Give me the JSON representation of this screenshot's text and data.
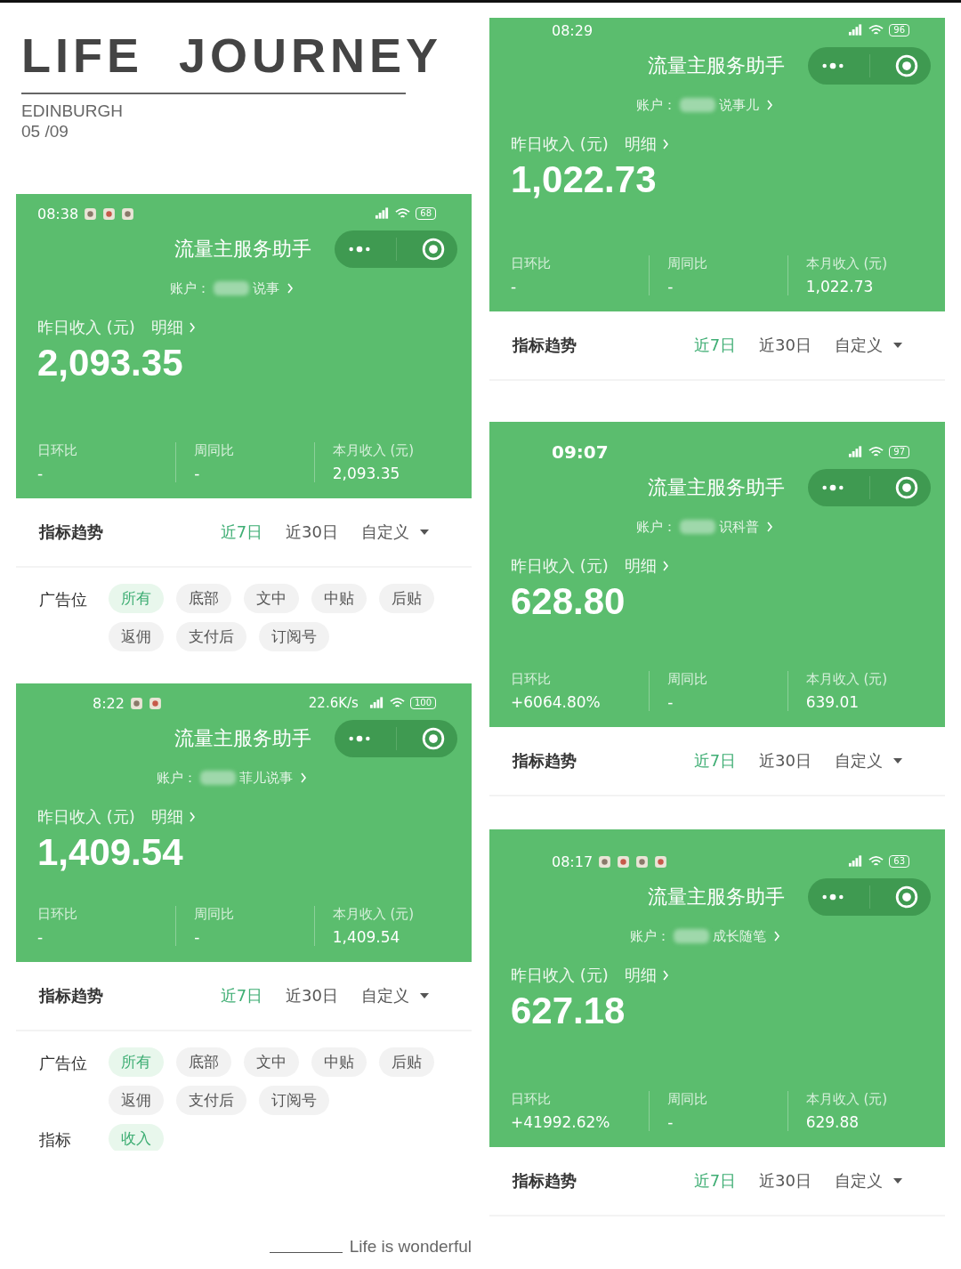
{
  "poster": {
    "title": "LIFE JOURNEY",
    "location": "EDINBURGH",
    "date": "05 /09",
    "footer": "Life is wonderful"
  },
  "left_column": [
    {
      "status_bar": {
        "time": "08:38",
        "battery": "68"
      },
      "app_title": "流量主服务助手",
      "account_label": "账户：",
      "account_name": "说事",
      "income_label": "昨日收入 (元)",
      "detail_link": "明细",
      "income": "2,093.35",
      "stats": [
        {
          "label": "日环比",
          "value": "-"
        },
        {
          "label": "周同比",
          "value": "-"
        },
        {
          "label": "本月收入 (元)",
          "value": "2,093.35"
        }
      ],
      "trend": {
        "title": "指标趋势",
        "tabs": [
          {
            "label": "近7日",
            "selected": true
          },
          {
            "label": "近30日",
            "selected": false
          },
          {
            "label": "自定义",
            "selected": false
          }
        ]
      },
      "filters": [
        {
          "label": "广告位",
          "chips": [
            {
              "label": "所有",
              "selected": true
            },
            {
              "label": "底部",
              "selected": false
            },
            {
              "label": "文中",
              "selected": false
            },
            {
              "label": "中贴",
              "selected": false
            },
            {
              "label": "后贴",
              "selected": false
            },
            {
              "label": "返佣",
              "selected": false
            },
            {
              "label": "支付后",
              "selected": false
            },
            {
              "label": "订阅号",
              "selected": false
            }
          ]
        }
      ]
    },
    {
      "status_bar": {
        "time": "8:22",
        "speed": "22.6K/s",
        "battery": "100"
      },
      "app_title": "流量主服务助手",
      "account_label": "账户：",
      "account_name": "菲儿说事",
      "income_label": "昨日收入 (元)",
      "detail_link": "明细",
      "income": "1,409.54",
      "stats": [
        {
          "label": "日环比",
          "value": "-"
        },
        {
          "label": "周同比",
          "value": "-"
        },
        {
          "label": "本月收入 (元)",
          "value": "1,409.54"
        }
      ],
      "trend": {
        "title": "指标趋势",
        "tabs": [
          {
            "label": "近7日",
            "selected": true
          },
          {
            "label": "近30日",
            "selected": false
          },
          {
            "label": "自定义",
            "selected": false
          }
        ]
      },
      "filters": [
        {
          "label": "广告位",
          "chips": [
            {
              "label": "所有",
              "selected": true
            },
            {
              "label": "底部",
              "selected": false
            },
            {
              "label": "文中",
              "selected": false
            },
            {
              "label": "中贴",
              "selected": false
            },
            {
              "label": "后贴",
              "selected": false
            },
            {
              "label": "返佣",
              "selected": false
            },
            {
              "label": "支付后",
              "selected": false
            },
            {
              "label": "订阅号",
              "selected": false
            }
          ]
        },
        {
          "label": "指标",
          "chips": [
            {
              "label": "收入",
              "selected": true
            }
          ]
        }
      ]
    }
  ],
  "right_column": [
    {
      "status_bar": {
        "time": "08:29",
        "battery": "96"
      },
      "app_title": "流量主服务助手",
      "account_label": "账户：",
      "account_name": "说事儿",
      "income_label": "昨日收入 (元)",
      "detail_link": "明细",
      "income": "1,022.73",
      "stats": [
        {
          "label": "日环比",
          "value": "-"
        },
        {
          "label": "周同比",
          "value": "-"
        },
        {
          "label": "本月收入 (元)",
          "value": "1,022.73"
        }
      ],
      "trend": {
        "title": "指标趋势",
        "tabs": [
          {
            "label": "近7日",
            "selected": true
          },
          {
            "label": "近30日",
            "selected": false
          },
          {
            "label": "自定义",
            "selected": false
          }
        ]
      }
    },
    {
      "status_bar": {
        "time": "09:07",
        "battery": "97"
      },
      "app_title": "流量主服务助手",
      "account_label": "账户：",
      "account_name": "识科普",
      "income_label": "昨日收入 (元)",
      "detail_link": "明细",
      "income": "628.80",
      "stats": [
        {
          "label": "日环比",
          "value": "+6064.80%"
        },
        {
          "label": "周同比",
          "value": "-"
        },
        {
          "label": "本月收入 (元)",
          "value": "639.01"
        }
      ],
      "trend": {
        "title": "指标趋势",
        "tabs": [
          {
            "label": "近7日",
            "selected": true
          },
          {
            "label": "近30日",
            "selected": false
          },
          {
            "label": "自定义",
            "selected": false
          }
        ]
      }
    },
    {
      "status_bar": {
        "time": "08:17",
        "battery": "63"
      },
      "app_title": "流量主服务助手",
      "account_label": "账户：",
      "account_name": "成长随笔",
      "income_label": "昨日收入 (元)",
      "detail_link": "明细",
      "income": "627.18",
      "stats": [
        {
          "label": "日环比",
          "value": "+41992.62%"
        },
        {
          "label": "周同比",
          "value": "-"
        },
        {
          "label": "本月收入 (元)",
          "value": "629.88"
        }
      ],
      "trend": {
        "title": "指标趋势",
        "tabs": [
          {
            "label": "近7日",
            "selected": true
          },
          {
            "label": "近30日",
            "selected": false
          },
          {
            "label": "自定义",
            "selected": false
          }
        ]
      }
    }
  ]
}
